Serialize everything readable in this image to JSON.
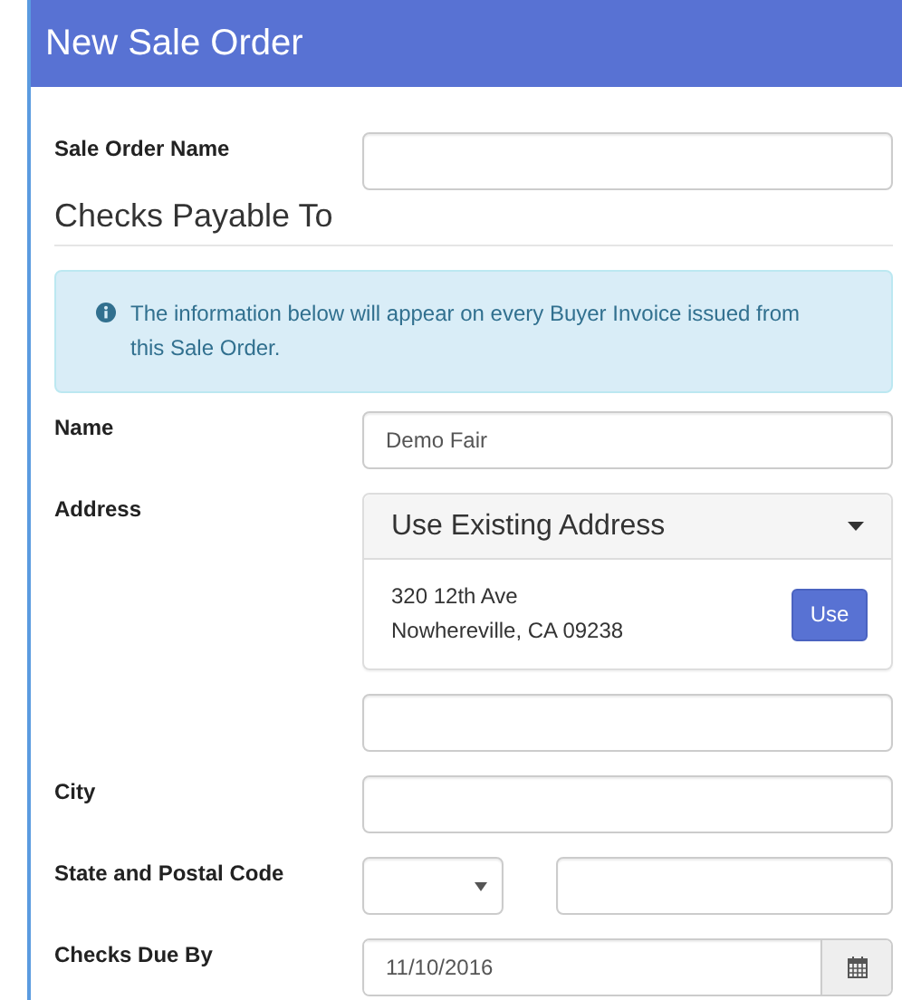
{
  "title": "New Sale Order",
  "rows": [
    {
      "kind": "text",
      "label": "Sale Order Name",
      "value": ""
    },
    {
      "kind": "heading",
      "text": "Checks Payable To"
    },
    {
      "kind": "notice",
      "text": "The information below will appear on every Buyer Invoice issued from this Sale Order."
    },
    {
      "kind": "text",
      "label": "Name",
      "value": "Demo Fair"
    },
    {
      "kind": "address",
      "label": "Address",
      "dropdown": "Use Existing Address",
      "lines": [
        "320 12th Ave",
        "Nowhereville, CA 09238"
      ],
      "button": "Use"
    },
    {
      "kind": "text",
      "value": ""
    },
    {
      "kind": "text",
      "label": "City",
      "value": ""
    },
    {
      "kind": "state_postal",
      "label": "State and Postal Code"
    },
    {
      "kind": "date",
      "label": "Checks Due By",
      "value": "11/10/2016"
    }
  ]
}
